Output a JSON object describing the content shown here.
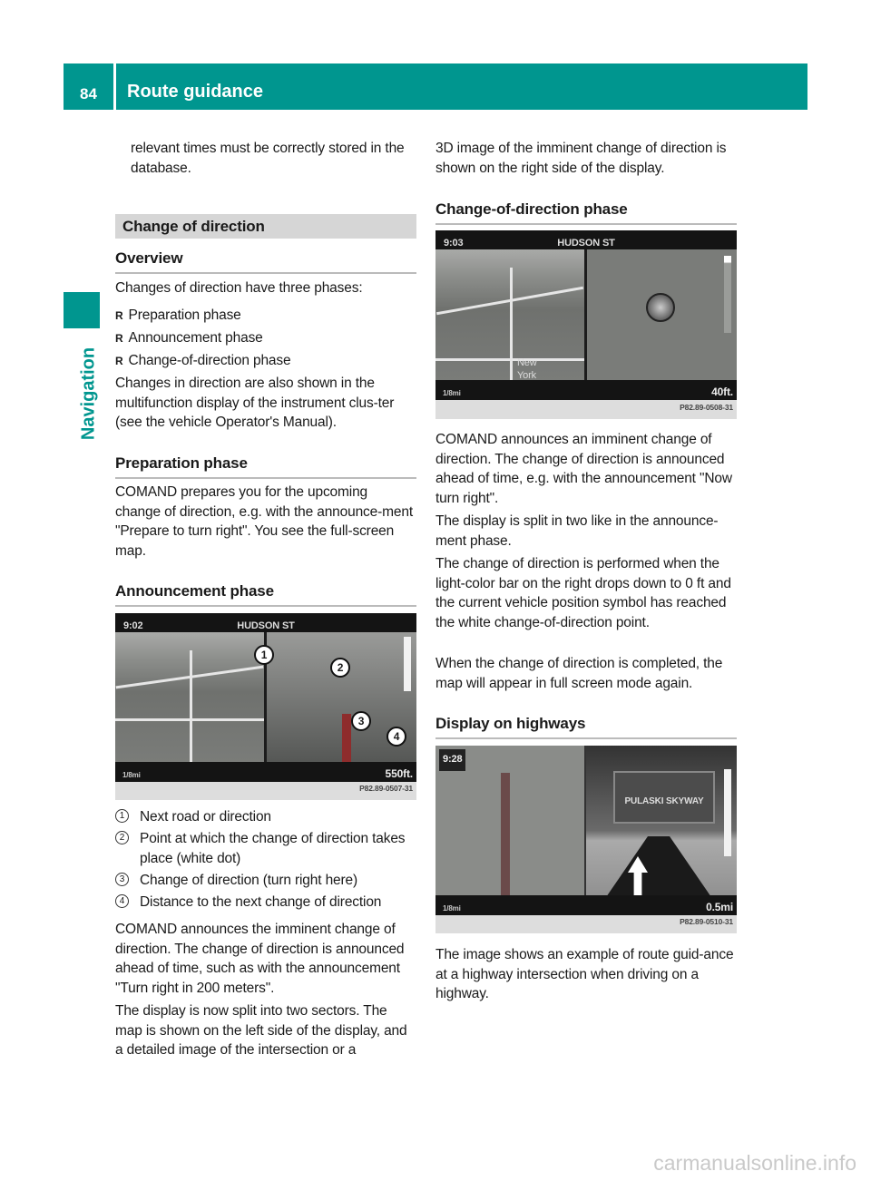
{
  "header": {
    "page_number": "84",
    "title": "Route guidance"
  },
  "sidebar": {
    "section": "Navigation"
  },
  "left": {
    "intro": "relevant times must be correctly stored in the database.",
    "section_bar": "Change of direction",
    "overview": {
      "heading": "Overview",
      "text": "Changes of direction have three phases:",
      "bullets": [
        "Preparation phase",
        "Announcement phase",
        "Change-of-direction phase"
      ],
      "bullet_glyph": "R",
      "after": "Changes in direction are also shown in the multifunction display of the instrument clus-ter (see the vehicle Operator's Manual)."
    },
    "preparation": {
      "heading": "Preparation phase",
      "text": "COMAND prepares you for the upcoming change of direction, e.g. with the announce-ment \"Prepare to turn right\". You see the full-screen map."
    },
    "announcement": {
      "heading": "Announcement phase",
      "figure": {
        "time": "9:02",
        "street": "HUDSON ST",
        "distance": "550ft.",
        "scale": "1/8mi",
        "code": "P82.89-0507-31",
        "callouts": [
          "1",
          "2",
          "3",
          "4"
        ]
      },
      "legend": [
        {
          "n": "1",
          "text": "Next road or direction"
        },
        {
          "n": "2",
          "text": "Point at which the change of direction takes place (white dot)"
        },
        {
          "n": "3",
          "text": "Change of direction (turn right here)"
        },
        {
          "n": "4",
          "text": "Distance to the next change of direction"
        }
      ],
      "p1": "COMAND announces the imminent change of direction. The change of direction is announced ahead of time, such as with the announcement \"Turn right in 200 meters\".",
      "p2": "The display is now split into two sectors. The map is shown on the left side of the display, and a detailed image of the intersection or a"
    }
  },
  "right": {
    "intro": "3D image of the imminent change of direction is shown on the right side of the display.",
    "cod": {
      "heading": "Change-of-direction phase",
      "figure": {
        "time": "9:03",
        "street": "HUDSON ST",
        "distance": "40ft.",
        "scale": "1/8mi",
        "map_label": "New York",
        "code": "P82.89-0508-31"
      },
      "p1": "COMAND announces an imminent change of direction. The change of direction is announced ahead of time, e.g. with the announcement \"Now turn right\".",
      "p2": "The display is split in two like in the announce-ment phase.",
      "p3": "The change of direction is performed when the light-color bar on the right drops down to 0 ft and the current vehicle position symbol has reached the white change-of-direction point.",
      "p4": "When the change of direction is completed, the map will appear in full screen mode again."
    },
    "highways": {
      "heading": "Display on highways",
      "figure": {
        "time": "9:28",
        "sign": "PULASKI SKYWAY",
        "distance": "0.5mi",
        "scale": "1/8mi",
        "code": "P82.89-0510-31"
      },
      "p1": "The image shows an example of route guid-ance at a highway intersection when driving on a highway."
    }
  },
  "watermark": "carmanualsonline.info",
  "colors": {
    "accent": "#00968f",
    "section_bar": "#d6d6d6"
  }
}
